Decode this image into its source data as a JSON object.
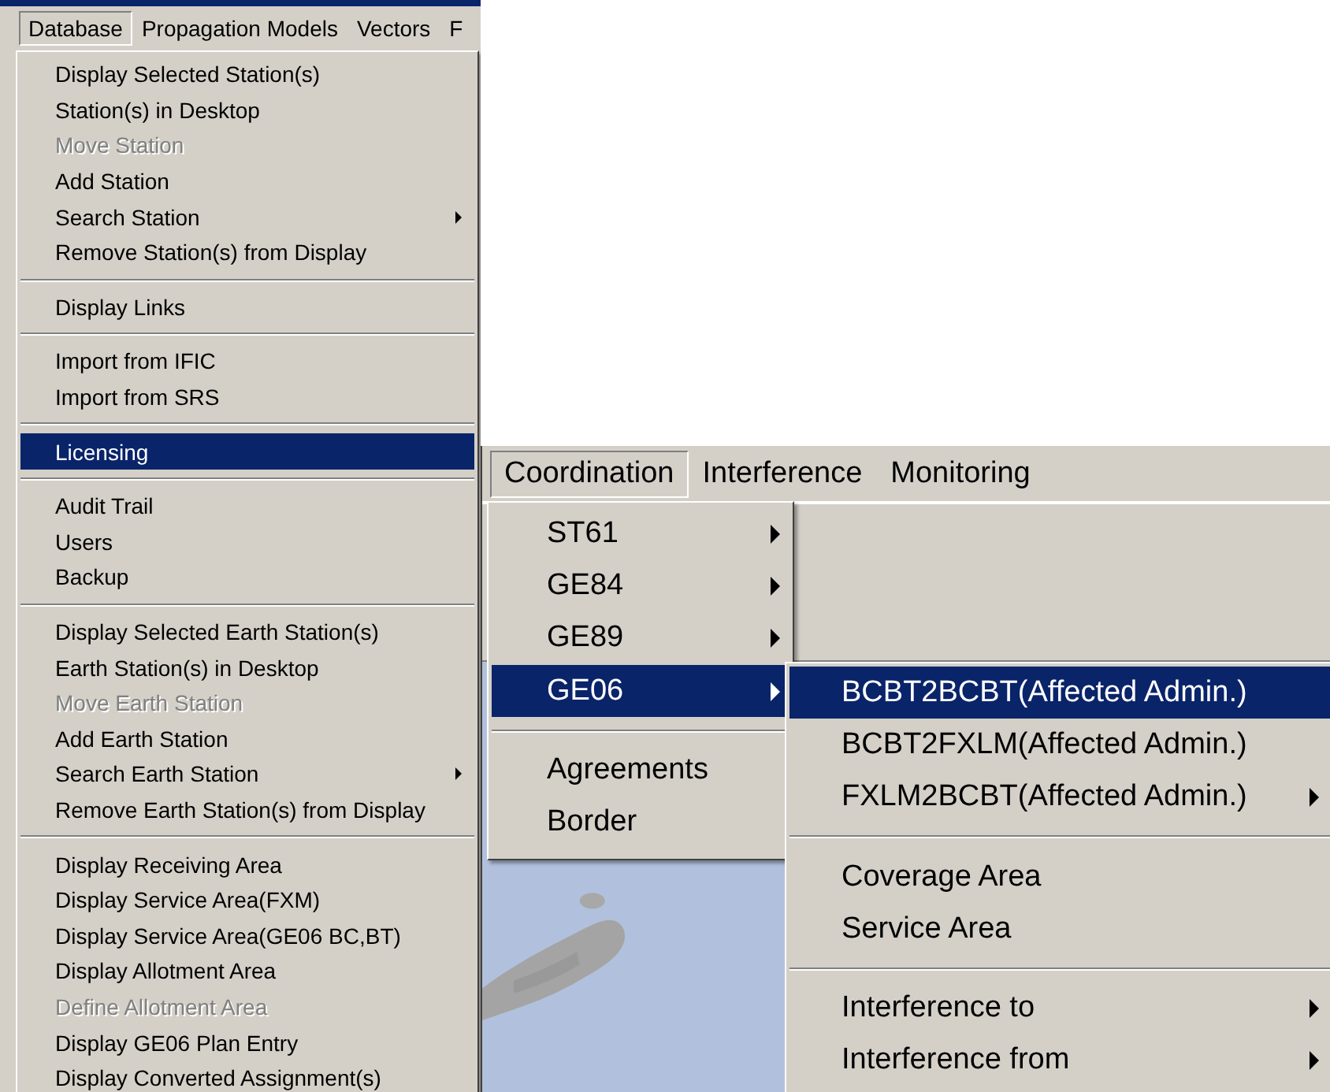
{
  "left_window": {
    "menubar": [
      {
        "label": "Database",
        "selected": true
      },
      {
        "label": "Propagation Models",
        "selected": false
      },
      {
        "label": "Vectors",
        "selected": false
      },
      {
        "label": "F",
        "selected": false
      }
    ],
    "menu": {
      "groups": [
        {
          "items": [
            {
              "label": "Display Selected Station(s)",
              "selected": false,
              "disabled": false,
              "submenu": false
            },
            {
              "label": "Station(s) in Desktop",
              "selected": false,
              "disabled": false,
              "submenu": false
            },
            {
              "label": "Move Station",
              "selected": false,
              "disabled": true,
              "submenu": false
            },
            {
              "label": "Add Station",
              "selected": false,
              "disabled": false,
              "submenu": false
            },
            {
              "label": "Search Station",
              "selected": false,
              "disabled": false,
              "submenu": true
            },
            {
              "label": "Remove Station(s) from Display",
              "selected": false,
              "disabled": false,
              "submenu": false
            }
          ]
        },
        {
          "items": [
            {
              "label": "Display Links",
              "selected": false,
              "disabled": false,
              "submenu": false
            }
          ]
        },
        {
          "items": [
            {
              "label": "Import from IFIC",
              "selected": false,
              "disabled": false,
              "submenu": false
            },
            {
              "label": "Import from SRS",
              "selected": false,
              "disabled": false,
              "submenu": false
            }
          ]
        },
        {
          "items": [
            {
              "label": "Licensing",
              "selected": true,
              "disabled": false,
              "submenu": false
            }
          ]
        },
        {
          "items": [
            {
              "label": "Audit Trail",
              "selected": false,
              "disabled": false,
              "submenu": false
            },
            {
              "label": "Users",
              "selected": false,
              "disabled": false,
              "submenu": false
            },
            {
              "label": "Backup",
              "selected": false,
              "disabled": false,
              "submenu": false
            }
          ]
        },
        {
          "items": [
            {
              "label": "Display Selected Earth Station(s)",
              "selected": false,
              "disabled": false,
              "submenu": false
            },
            {
              "label": "Earth Station(s) in Desktop",
              "selected": false,
              "disabled": false,
              "submenu": false
            },
            {
              "label": "Move Earth Station",
              "selected": false,
              "disabled": true,
              "submenu": false
            },
            {
              "label": "Add Earth Station",
              "selected": false,
              "disabled": false,
              "submenu": false
            },
            {
              "label": "Search Earth Station",
              "selected": false,
              "disabled": false,
              "submenu": true
            },
            {
              "label": "Remove Earth Station(s) from Display",
              "selected": false,
              "disabled": false,
              "submenu": false
            }
          ]
        },
        {
          "items": [
            {
              "label": "Display Receiving Area",
              "selected": false,
              "disabled": false,
              "submenu": false
            },
            {
              "label": "Display Service Area(FXM)",
              "selected": false,
              "disabled": false,
              "submenu": false
            },
            {
              "label": "Display Service Area(GE06 BC,BT)",
              "selected": false,
              "disabled": false,
              "submenu": false
            },
            {
              "label": "Display Allotment Area",
              "selected": false,
              "disabled": false,
              "submenu": false
            },
            {
              "label": "Define Allotment Area",
              "selected": false,
              "disabled": true,
              "submenu": false
            },
            {
              "label": "Display GE06 Plan Entry",
              "selected": false,
              "disabled": false,
              "submenu": false
            },
            {
              "label": "Display Converted Assignment(s)",
              "selected": false,
              "disabled": false,
              "submenu": false
            }
          ]
        }
      ]
    }
  },
  "right_window": {
    "menubar": [
      {
        "label": "Coordination",
        "selected": true
      },
      {
        "label": "Interference",
        "selected": false
      },
      {
        "label": "Monitoring",
        "selected": false
      }
    ],
    "menu": {
      "groups": [
        {
          "items": [
            {
              "label": "ST61",
              "selected": false,
              "disabled": false,
              "submenu": true
            },
            {
              "label": "GE84",
              "selected": false,
              "disabled": false,
              "submenu": true
            },
            {
              "label": "GE89",
              "selected": false,
              "disabled": false,
              "submenu": true
            },
            {
              "label": "GE06",
              "selected": true,
              "disabled": false,
              "submenu": true
            }
          ]
        },
        {
          "items": [
            {
              "label": "Agreements",
              "selected": false,
              "disabled": false,
              "submenu": false
            },
            {
              "label": "Border",
              "selected": false,
              "disabled": false,
              "submenu": false
            }
          ]
        }
      ]
    },
    "submenu": {
      "groups": [
        {
          "items": [
            {
              "label": "BCBT2BCBT(Affected Admin.)",
              "selected": true,
              "disabled": false,
              "submenu": false
            },
            {
              "label": "BCBT2FXLM(Affected Admin.)",
              "selected": false,
              "disabled": false,
              "submenu": false
            },
            {
              "label": "FXLM2BCBT(Affected Admin.)",
              "selected": false,
              "disabled": false,
              "submenu": true
            }
          ]
        },
        {
          "items": [
            {
              "label": "Coverage Area",
              "selected": false,
              "disabled": false,
              "submenu": false
            },
            {
              "label": "Service Area",
              "selected": false,
              "disabled": false,
              "submenu": false
            }
          ]
        },
        {
          "items": [
            {
              "label": "Interference to",
              "selected": false,
              "disabled": false,
              "submenu": true
            },
            {
              "label": "Interference from",
              "selected": false,
              "disabled": false,
              "submenu": true
            }
          ]
        }
      ]
    }
  }
}
